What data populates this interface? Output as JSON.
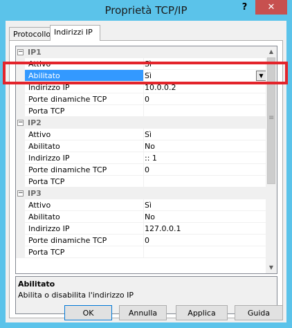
{
  "window": {
    "title": "Proprietà TCP/IP",
    "help_glyph": "?",
    "close_glyph": "✕"
  },
  "tabs": [
    {
      "label": "Protocollo",
      "active": false
    },
    {
      "label": "Indirizzi IP",
      "active": true
    }
  ],
  "grid": {
    "expander_glyph": "−",
    "dropdown_glyph": "▼",
    "categories": [
      {
        "label": "IP1",
        "properties": [
          {
            "name": "Attivo",
            "value": "Sì"
          },
          {
            "name": "Abilitato",
            "value": "Sì",
            "selected": true
          },
          {
            "name": "Indirizzo IP",
            "value": "10.0.0.2"
          },
          {
            "name": "Porte dinamiche TCP",
            "value": "0"
          },
          {
            "name": "Porta TCP",
            "value": ""
          }
        ]
      },
      {
        "label": "IP2",
        "properties": [
          {
            "name": "Attivo",
            "value": "Sì"
          },
          {
            "name": "Abilitato",
            "value": "No"
          },
          {
            "name": "Indirizzo IP",
            "value": ":: 1"
          },
          {
            "name": "Porte dinamiche TCP",
            "value": "0"
          },
          {
            "name": "Porta TCP",
            "value": ""
          }
        ]
      },
      {
        "label": "IP3",
        "properties": [
          {
            "name": "Attivo",
            "value": "Sì"
          },
          {
            "name": "Abilitato",
            "value": "No"
          },
          {
            "name": "Indirizzo IP",
            "value": "127.0.0.1"
          },
          {
            "name": "Porte dinamiche TCP",
            "value": "0"
          },
          {
            "name": "Porta TCP",
            "value": ""
          }
        ]
      }
    ],
    "scrollbar": {
      "up_glyph": "▲",
      "down_glyph": "▼",
      "grip_glyph": "≡"
    }
  },
  "description": {
    "title": "Abilitato",
    "text": "Abilita o disabilita l'indirizzo IP"
  },
  "buttons": {
    "ok": "OK",
    "annulla": "Annulla",
    "applica": "Applica",
    "guida": "Guida"
  },
  "colors": {
    "titlebar": "#5bc3ea",
    "close": "#c7504f",
    "selection": "#3399ff",
    "annotation": "#e3242b"
  }
}
